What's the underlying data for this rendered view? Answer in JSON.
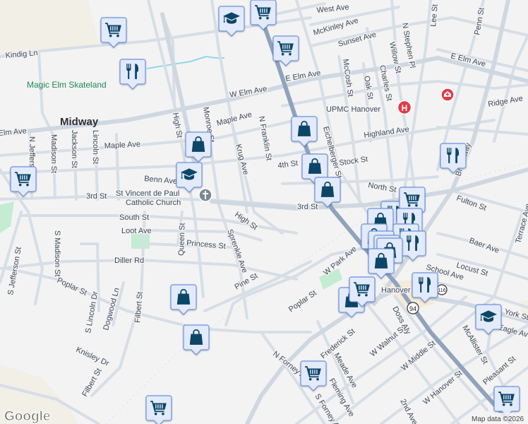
{
  "map": {
    "places": {
      "midway": "Midway",
      "skateland": "Magic Elm Skateland",
      "church_line1": "St Vincent de Paul",
      "church_line2": "Catholic Church",
      "hospital": "UPMC Hanover",
      "hanover": "Hanover"
    },
    "streets": {
      "west_ave": "West Ave",
      "mckinley_ave": "McKinley Ave",
      "sunset_ave": "Sunset Ave",
      "e_elm_ave_1": "E Elm Ave",
      "e_elm_ave_2": "E Elm Ave",
      "lee_st": "Lee St",
      "penn_st": "Penn St",
      "n_stephen_pl": "N Stephen Pl",
      "willow_st": "Willow St",
      "mccosh_st": "McCosh St",
      "oak_st": "Oak St",
      "charles_st": "Charles St",
      "ridge_ave": "Ridge Ave",
      "highland_ave": "Highland Ave",
      "stock_st": "Stock St",
      "fourth_st": "4th St",
      "north_st": "North St",
      "fulton_st": "Fulton St",
      "eichelberger_st": "Eichelberger St",
      "n_franklin_st": "N Franklin St",
      "broadway": "Broadway",
      "third_st_east": "3rd St",
      "third_st_west": "3rd St",
      "w_elm_ave": "W Elm Ave",
      "elm_ave": "Elm Ave",
      "maple_ave_1": "Maple Ave",
      "maple_ave_2": "Maple Ave",
      "kindig_ln": "Kindig Ln",
      "high_st_1": "High St",
      "monroe_st": "Monroe St",
      "krug_ave": "Krug Ave",
      "n_jefferson_st": "N Jefferson St",
      "madison_st": "Madison St",
      "jackson_st": "Jackson St",
      "lincoln_st": "Lincoln St",
      "benn_ave": "Benn Ave",
      "south_st": "South St",
      "loot_ave": "Loot Ave",
      "princess_st": "Princess St",
      "queen_st": "Queen St",
      "sprenkle_ave": "Sprenkle Ave",
      "high_st_2": "High St",
      "diller_rd": "Diller Rd",
      "poplar_st_1": "Poplar St",
      "s_madison_st": "S Madison St",
      "jefferson_st": "S Jefferson St",
      "s_lincoln_dr": "S Lincoln Dr",
      "dogwood_ln": "Dogwood Ln",
      "filbert_st_1": "Filbert St",
      "filbert_st_2": "Filbert St",
      "knisley_dr": "Knisley Dr",
      "pine_st": "Pine St",
      "w_park_ave": "W Park Ave",
      "poplar_st_2": "Poplar St",
      "frederick_st": "Frederick St",
      "meade_ave": "Meade Ave",
      "w_walnut_st": "W Walnut St",
      "w_middle_st": "W Middle St",
      "doss_aly": "Doss Aly",
      "w_hanover_st": "W Hanover St",
      "second_ave": "2nd Ave",
      "n_forney_ave": "N Forney Ave",
      "s_forney_ave": "S Forney Ave",
      "fleming_ave": "Fleming Ave",
      "baer_ave": "Baer Ave",
      "locust_st": "Locust St",
      "school_ave": "School Ave",
      "york_st": "York St",
      "eagle_ave": "Eagle Ave",
      "mcallister_st": "McAllister St",
      "pleasant_st": "Pleasant St",
      "terrace_ave": "Terrace Ave"
    },
    "route_shields": [
      "94",
      "116"
    ],
    "markers": [
      "cart",
      "cart",
      "cart",
      "school",
      "restaurant",
      "cart",
      "bag",
      "school",
      "bag",
      "bag",
      "bag",
      "restaurant",
      "restaurant",
      "cart",
      "bag",
      "restaurant",
      "bag",
      "restaurant",
      "bag",
      "restaurant",
      "bag",
      "bag",
      "restaurant",
      "bag",
      "cart",
      "bag",
      "bag",
      "school",
      "cart",
      "cart",
      "cart",
      "bag"
    ],
    "colors": {
      "background": "#f4f3f4",
      "marker_fill": "#e2eafb",
      "marker_border": "#6d94dc",
      "marker_icon": "#0c4666",
      "hospital": "#e53945",
      "park": "#c3ecd2",
      "highway": "#8fa3bb"
    },
    "attribution": "Map data ©2026",
    "logo": "Google"
  }
}
